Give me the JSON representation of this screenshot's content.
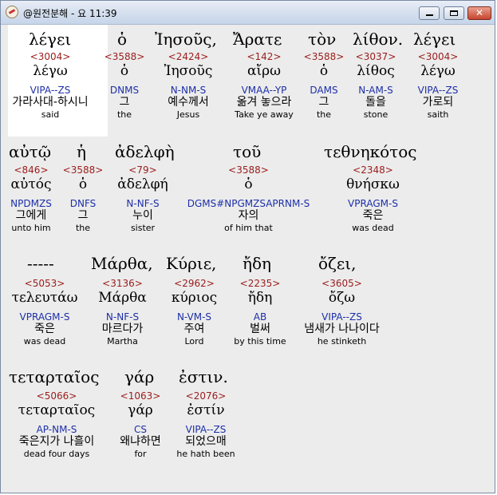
{
  "window": {
    "title": "@원전분해 - 요 11:39",
    "icon": "app-logo-icon",
    "controls": {
      "minimize": "minimize-icon",
      "maximize": "maximize-icon",
      "close": "close-icon"
    },
    "close_glyph": "✕"
  },
  "line1": {
    "surface": [
      "λέγει",
      "ὁ",
      "Ἰησοῦς,",
      "Ἄρατε",
      "τὸν",
      "λίθον.",
      "λέγει"
    ],
    "words": [
      {
        "strong": "<3004>",
        "lemma": "λέγω",
        "morph": "VIPA--ZS",
        "korean": "가라사대-하시니",
        "english": "said"
      },
      {
        "strong": "<3588>",
        "lemma": "ὁ",
        "morph": "DNMS",
        "korean": "그",
        "english": "the"
      },
      {
        "strong": "<2424>",
        "lemma": "Ἰησοῦς",
        "morph": "N-NM-S",
        "korean": "예수께서",
        "english": "Jesus"
      },
      {
        "strong": "<142>",
        "lemma": "αἴρω",
        "morph": "VMAA--YP",
        "korean": "옮겨 놓으라",
        "english": "Take ye away"
      },
      {
        "strong": "<3588>",
        "lemma": "ὁ",
        "morph": "DAMS",
        "korean": "그",
        "english": "the"
      },
      {
        "strong": "<3037>",
        "lemma": "λίθος",
        "morph": "N-AM-S",
        "korean": "돌을",
        "english": "stone"
      },
      {
        "strong": "<3004>",
        "lemma": "λέγω",
        "morph": "VIPA--ZS",
        "korean": "가로되",
        "english": "saith"
      }
    ]
  },
  "line2": {
    "surface": [
      "αὐτῷ",
      "ἡ",
      "ἀδελφὴ",
      "τοῦ",
      "τεθνηκότος"
    ],
    "words": [
      {
        "strong": "<846>",
        "lemma": "αὐτός",
        "morph": "NPDMZS",
        "korean": "그에게",
        "english": "unto him"
      },
      {
        "strong": "<3588>",
        "lemma": "ὁ",
        "morph": "DNFS",
        "korean": "그",
        "english": "the"
      },
      {
        "strong": "<79>",
        "lemma": "ἀδελφή",
        "morph": "N-NF-S",
        "korean": "누이",
        "english": "sister"
      },
      {
        "strong": "<3588>",
        "lemma": "ὁ",
        "morph": "DGMS#NPGMZSAPRNM-S",
        "korean": "자의",
        "english": "of him that"
      },
      {
        "strong": "<2348>",
        "lemma": "θνήσκω",
        "morph": "VPRAGM-S",
        "korean": "죽은",
        "english": "was dead"
      }
    ]
  },
  "line3": {
    "surface": [
      "-----",
      "Μάρθα,",
      "Κύριε,",
      "ἤδη",
      "ὄζει,"
    ],
    "words": [
      {
        "strong": "<5053>",
        "lemma": "τελευτάω",
        "morph": "VPRAGM-S",
        "korean": "죽은",
        "english": "was dead"
      },
      {
        "strong": "<3136>",
        "lemma": "Μάρθα",
        "morph": "N-NF-S",
        "korean": "마르다가",
        "english": "Martha"
      },
      {
        "strong": "<2962>",
        "lemma": "κύριος",
        "morph": "N-VM-S",
        "korean": "주여",
        "english": "Lord"
      },
      {
        "strong": "<2235>",
        "lemma": "ἤδη",
        "morph": "AB",
        "korean": "벌써",
        "english": "by this time"
      },
      {
        "strong": "<3605>",
        "lemma": "ὄζω",
        "morph": "VIPA--ZS",
        "korean": "냄새가 나나이다",
        "english": "he stinketh"
      }
    ]
  },
  "line4": {
    "surface": [
      "τεταρταῖος",
      "γάρ",
      "ἐστιν."
    ],
    "words": [
      {
        "strong": "<5066>",
        "lemma": "τεταρταῖος",
        "morph": "AP-NM-S",
        "korean": "죽은지가 나흘이",
        "english": "dead four days"
      },
      {
        "strong": "<1063>",
        "lemma": "γάρ",
        "morph": "CS",
        "korean": "왜냐하면",
        "english": "for"
      },
      {
        "strong": "<2076>",
        "lemma": "ἐστίν",
        "morph": "VIPA--ZS",
        "korean": "되었으매",
        "english": "he hath been"
      }
    ]
  }
}
